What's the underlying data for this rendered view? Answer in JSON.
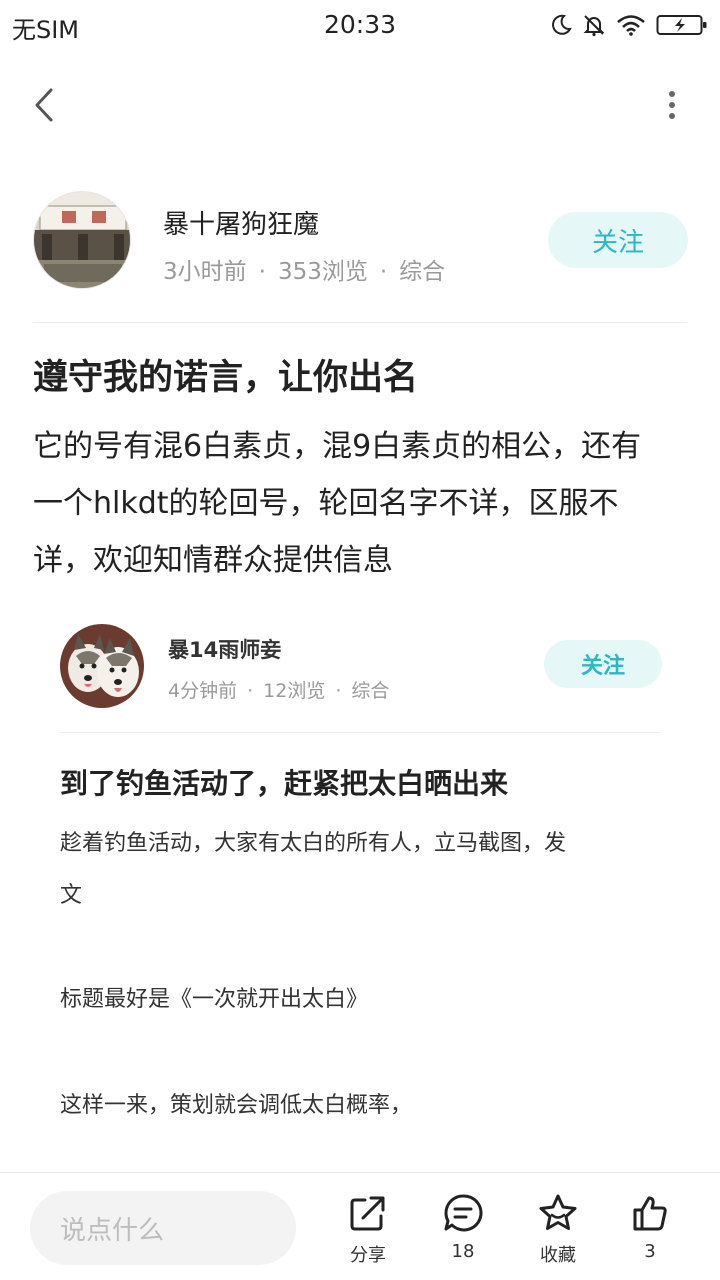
{
  "status": {
    "carrier": "无SIM",
    "time": "20:33"
  },
  "nav": {
    "back_icon": "chevron-left-icon",
    "more_icon": "more-vertical-icon"
  },
  "author": {
    "name": "暴十屠狗狂魔",
    "time_ago": "3小时前",
    "views": "353浏览",
    "category": "综合",
    "follow_label": "关注"
  },
  "post": {
    "title": "遵守我的诺言，让你出名",
    "body_lines": [
      "它的号有混6白素贞，混9白素贞的相公，还有",
      "一个hlkdt的轮回号，轮回名字不详，区服不",
      "详，欢迎知情群众提供信息"
    ]
  },
  "embedded": {
    "name": "暴14雨师妾",
    "time_ago": "4分钟前",
    "views": "12浏览",
    "category": "综合",
    "follow_label": "关注",
    "title": "到了钓鱼活动了，赶紧把太白晒出来",
    "paragraphs": [
      "趁着钓鱼活动，大家有太白的所有人，立马截图，发",
      "文",
      "标题最好是《一次就开出太白》",
      "这样一来，策划就会调低太白概率，"
    ]
  },
  "bottom": {
    "comment_placeholder": "说点什么",
    "share_label": "分享",
    "comment_count": "18",
    "favorite_label": "收藏",
    "like_count": "3"
  },
  "colors": {
    "accent": "#2bb8c0",
    "follow_bg": "#e6f7f8",
    "meta_gray": "#9a9a9a"
  }
}
